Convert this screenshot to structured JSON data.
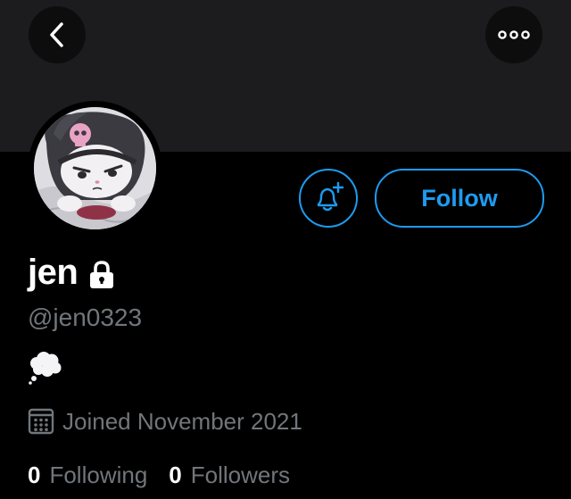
{
  "profile": {
    "display_name": "jen",
    "handle": "@jen0323",
    "bio": "💭",
    "joined": "Joined November 2021",
    "following_count": "0",
    "following_label": "Following",
    "followers_count": "0",
    "followers_label": "Followers",
    "protected": true
  },
  "actions": {
    "follow_label": "Follow"
  },
  "icons": {
    "back": "chevron-left-icon",
    "more": "more-horizontal-icon",
    "notify": "bell-plus-icon",
    "lock": "lock-icon",
    "calendar": "calendar-icon"
  },
  "colors": {
    "accent": "#1d9bf0",
    "secondary_text": "#71767b",
    "banner": "#1c1c1e",
    "background": "#000000"
  }
}
